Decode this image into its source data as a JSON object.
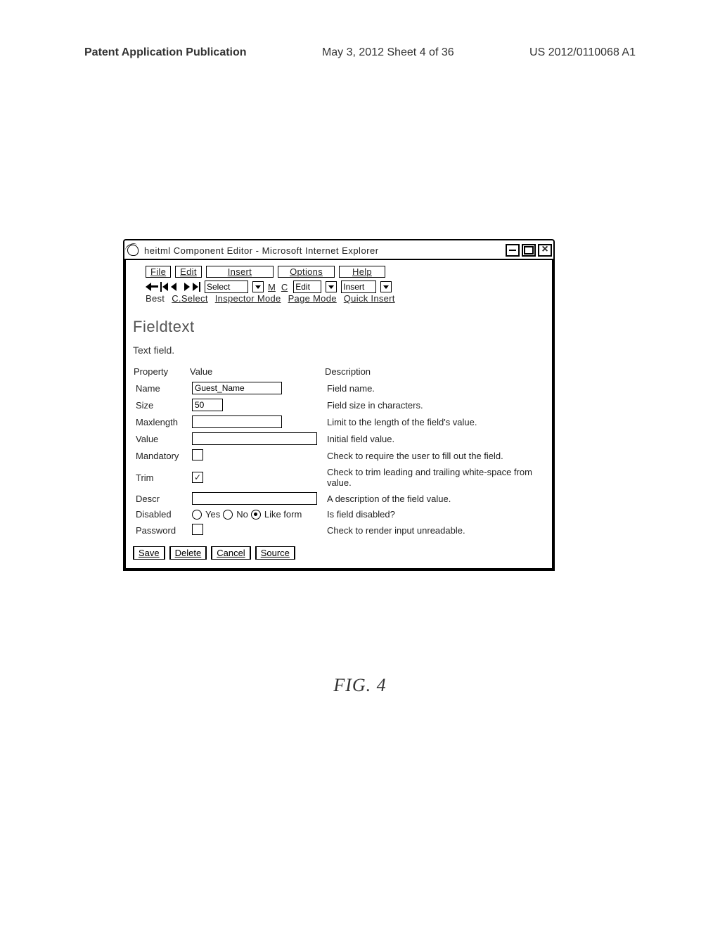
{
  "page_header": {
    "left": "Patent Application Publication",
    "center": "May 3, 2012   Sheet 4 of 36",
    "right": "US 2012/0110068 A1"
  },
  "window": {
    "title": "heitml Component Editor - Microsoft Internet Explorer",
    "menubar": {
      "file": "File",
      "edit": "Edit",
      "insert": "Insert",
      "options": "Options",
      "help": "Help"
    },
    "toolbar": {
      "select_value": "Select",
      "m_label": "M",
      "c_label": "C",
      "edit_value": "Edit",
      "insert_value": "Insert",
      "row2": {
        "best": "Best",
        "cselect": "C.Select",
        "inspector": "Inspector Mode",
        "page_mode": "Page Mode",
        "quick_insert": "Quick Insert"
      }
    },
    "component": {
      "title": "Fieldtext",
      "subtitle": "Text field.",
      "headers": {
        "property": "Property",
        "value": "Value",
        "description": "Description"
      },
      "rows": [
        {
          "prop": "Name",
          "value": "Guest_Name",
          "desc": "Field name."
        },
        {
          "prop": "Size",
          "value": "50",
          "desc": "Field size in characters."
        },
        {
          "prop": "Maxlength",
          "value": "",
          "desc": "Limit to the length of the field's value."
        },
        {
          "prop": "Value",
          "value": "",
          "desc": "Initial field value."
        },
        {
          "prop": "Mandatory",
          "checked": false,
          "desc": "Check to require the user to fill out the field."
        },
        {
          "prop": "Trim",
          "checked": true,
          "desc": "Check to trim leading and trailing white-space from value."
        },
        {
          "prop": "Descr",
          "value": "",
          "desc": "A description of the field value."
        },
        {
          "prop": "Disabled",
          "radio": {
            "yes": "Yes",
            "no": "No",
            "like": "Like form",
            "selected": "like"
          },
          "desc": "Is field disabled?"
        },
        {
          "prop": "Password",
          "checked": false,
          "desc": "Check to render input unreadable."
        }
      ],
      "buttons": {
        "save": "Save",
        "delete": "Delete",
        "cancel": "Cancel",
        "source": "Source"
      }
    }
  },
  "figure_label": "FIG. 4"
}
